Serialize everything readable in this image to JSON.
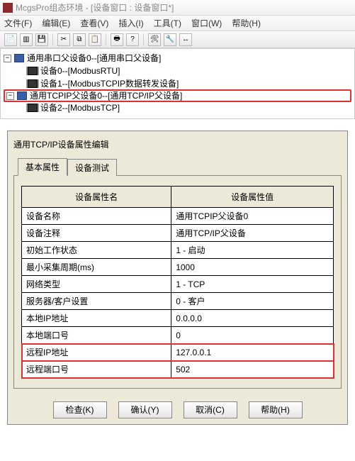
{
  "titlebar": {
    "text": "McgsPro组态环境 - [设备窗口 : 设备窗口*]"
  },
  "menus": {
    "file": "文件(F)",
    "edit": "编辑(E)",
    "view": "查看(V)",
    "insert": "插入(I)",
    "tools": "工具(T)",
    "window": "窗口(W)",
    "help": "帮助(H)"
  },
  "toolbar_icons": [
    "📄",
    "🖉",
    "📋",
    "|",
    "✂",
    "📄",
    "📋",
    "|",
    "🖨",
    "❓",
    "|",
    "🛠",
    "🔧",
    "↔"
  ],
  "tree": {
    "n0": "通用串口父设备0--[通用串口父设备]",
    "n0c0": "设备0--[ModbusRTU]",
    "n0c1": "设备1--[ModbusTCPIP数据转发设备]",
    "n1": "通用TCPIP父设备0--[通用TCP/IP父设备]",
    "n1c0": "设备2--[ModbusTCP]"
  },
  "dialog": {
    "title": "通用TCP/IP设备属性编辑",
    "tab_basic": "基本属性",
    "tab_test": "设备测试",
    "col_name": "设备属性名",
    "col_value": "设备属性值",
    "rows": [
      {
        "name": "设备名称",
        "value": "通用TCPIP父设备0"
      },
      {
        "name": "设备注释",
        "value": "通用TCP/IP父设备"
      },
      {
        "name": "初始工作状态",
        "value": "1 - 启动"
      },
      {
        "name": "最小采集周期(ms)",
        "value": "1000"
      },
      {
        "name": "网络类型",
        "value": "1 - TCP"
      },
      {
        "name": "服务器/客户设置",
        "value": "0 - 客户"
      },
      {
        "name": "本地IP地址",
        "value": "0.0.0.0"
      },
      {
        "name": "本地端口号",
        "value": "0"
      },
      {
        "name": "远程IP地址",
        "value": "127.0.0.1"
      },
      {
        "name": "远程端口号",
        "value": "502"
      }
    ],
    "btn_check": "检查(K)",
    "btn_ok": "确认(Y)",
    "btn_cancel": "取消(C)",
    "btn_help": "帮助(H)"
  }
}
